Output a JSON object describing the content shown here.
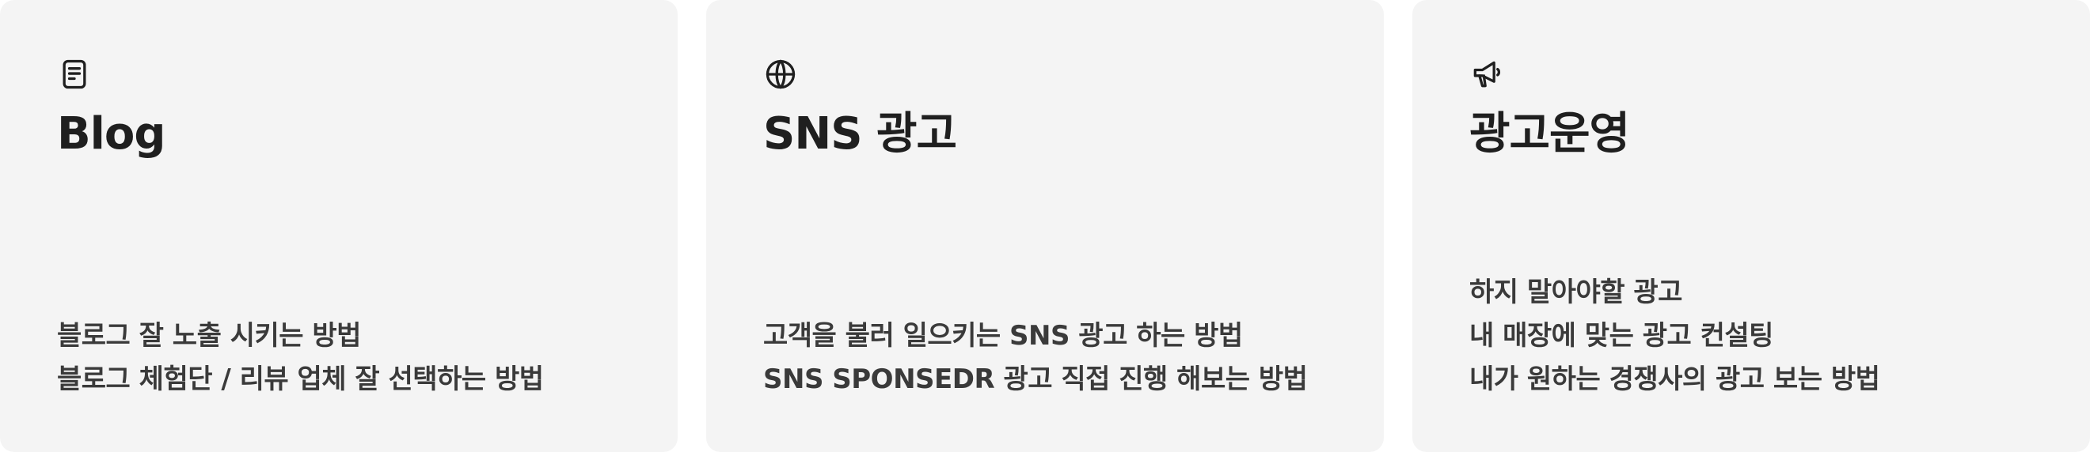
{
  "cards": [
    {
      "icon": "document-icon",
      "title": "Blog",
      "items": [
        "블로그 잘 노출 시키는 방법",
        "블로그 체험단 / 리뷰 업체 잘 선택하는 방법"
      ]
    },
    {
      "icon": "globe-icon",
      "title": "SNS 광고",
      "items": [
        "고객을 불러 일으키는 SNS 광고 하는 방법",
        "SNS SPONSEDR 광고 직접 진행 해보는 방법"
      ]
    },
    {
      "icon": "megaphone-icon",
      "title": "광고운영",
      "items": [
        "하지 말아야할 광고",
        "내 매장에 맞는 광고 컨설팅",
        "내가 원하는 경쟁사의 광고 보는 방법"
      ]
    }
  ]
}
